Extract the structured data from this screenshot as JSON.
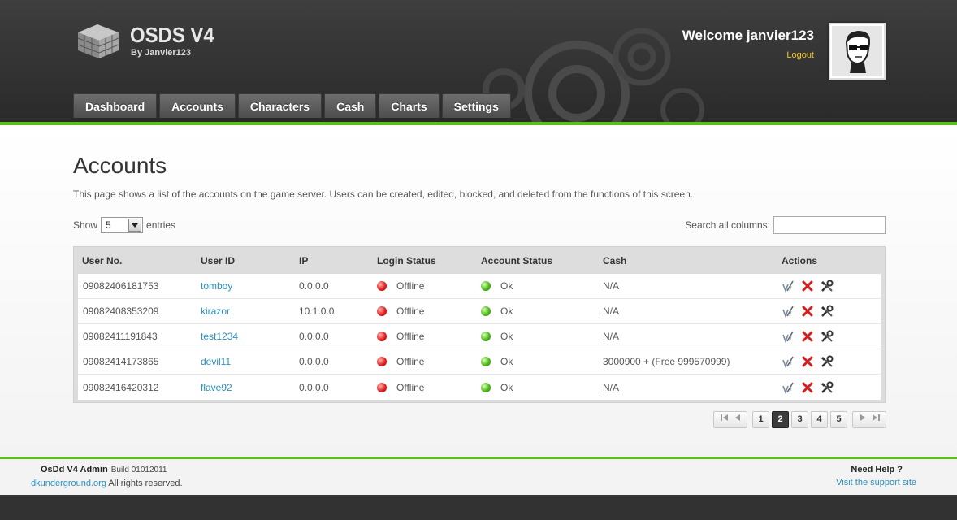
{
  "header": {
    "logo_title": "OSDS V4",
    "logo_subtitle": "By Janvier123",
    "welcome": "Welcome janvier123",
    "logout": "Logout"
  },
  "nav": {
    "items": [
      {
        "label": "Dashboard"
      },
      {
        "label": "Accounts"
      },
      {
        "label": "Characters"
      },
      {
        "label": "Cash"
      },
      {
        "label": "Charts"
      },
      {
        "label": "Settings"
      }
    ]
  },
  "main": {
    "title": "Accounts",
    "description": "This page shows a list of the accounts on the game server. Users can be created, edited, blocked, and deleted from the functions of this screen.",
    "show_label": "Show",
    "entries_value": "5",
    "entries_label": "entries",
    "search_label": "Search all columns:",
    "search_value": ""
  },
  "table": {
    "columns": [
      "User No.",
      "User ID",
      "IP",
      "Login Status",
      "Account Status",
      "Cash",
      "Actions"
    ],
    "rows": [
      {
        "user_no": "09082406181753",
        "user_id": "tomboy",
        "ip": "0.0.0.0",
        "login_status": "Offline",
        "account_status": "Ok",
        "cash": "N/A"
      },
      {
        "user_no": "09082408353209",
        "user_id": "kirazor",
        "ip": "10.1.0.0",
        "login_status": "Offline",
        "account_status": "Ok",
        "cash": "N/A"
      },
      {
        "user_no": "09082411191843",
        "user_id": "test1234",
        "ip": "0.0.0.0",
        "login_status": "Offline",
        "account_status": "Ok",
        "cash": "N/A"
      },
      {
        "user_no": "09082414173865",
        "user_id": "devil11",
        "ip": "0.0.0.0",
        "login_status": "Offline",
        "account_status": "Ok",
        "cash": "3000900 + (Free 999570999)"
      },
      {
        "user_no": "09082416420312",
        "user_id": "flave92",
        "ip": "0.0.0.0",
        "login_status": "Offline",
        "account_status": "Ok",
        "cash": "N/A"
      }
    ]
  },
  "pagination": {
    "pages": [
      "1",
      "2",
      "3",
      "4",
      "5"
    ],
    "current": "2"
  },
  "footer": {
    "app_name": "OsDd V4 Admin",
    "build": "Build 01012011",
    "site_link": "dkunderground.org",
    "rights": "All rights reserved.",
    "help_title": "Need Help ?",
    "help_link": "Visit the support site"
  },
  "colors": {
    "accent_green": "#5bbf1a",
    "link_blue": "#2a8fbd",
    "logout_yellow": "#f3c51c"
  }
}
